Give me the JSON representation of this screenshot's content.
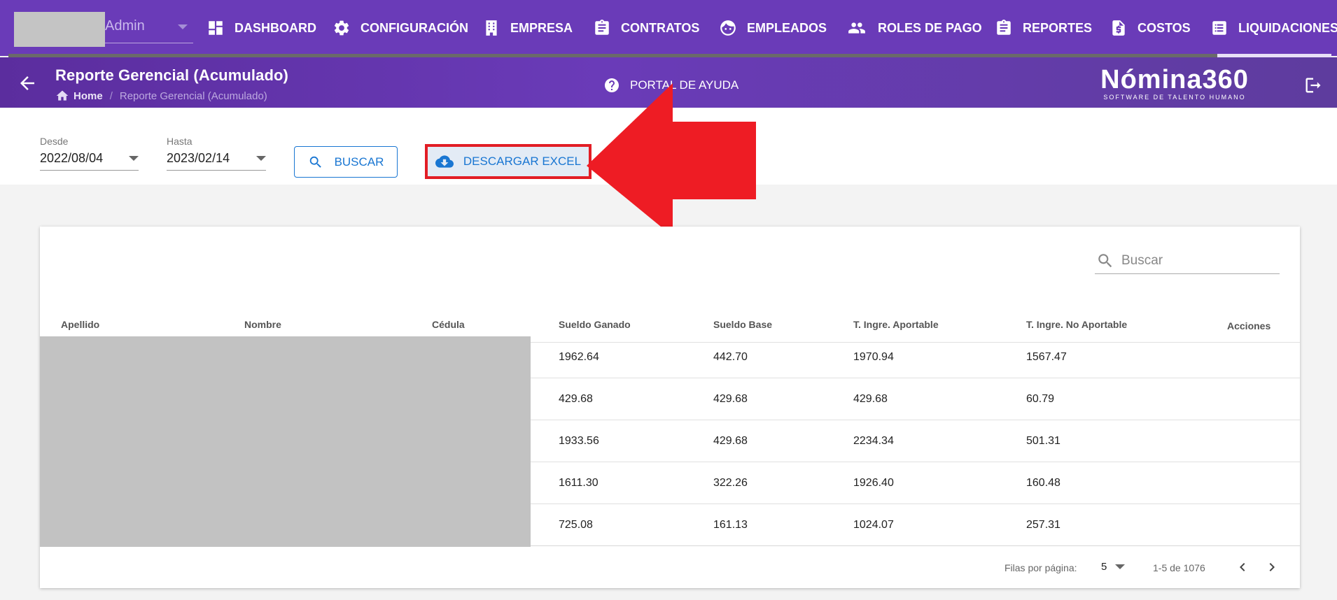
{
  "topnav": {
    "user_name": "Admin",
    "items": [
      {
        "label": "DASHBOARD",
        "icon": "dashboard-icon"
      },
      {
        "label": "CONFIGURACIÓN",
        "icon": "gear-icon"
      },
      {
        "label": "EMPRESA",
        "icon": "building-icon"
      },
      {
        "label": "CONTRATOS",
        "icon": "clipboard-icon"
      },
      {
        "label": "EMPLEADOS",
        "icon": "face-icon"
      },
      {
        "label": "ROLES DE PAGO",
        "icon": "people-icon"
      },
      {
        "label": "REPORTES",
        "icon": "clipboard-icon"
      },
      {
        "label": "COSTOS",
        "icon": "dollar-file-icon"
      },
      {
        "label": "LIQUIDACIONES",
        "icon": "list-icon"
      }
    ]
  },
  "header": {
    "title": "Reporte Gerencial (Acumulado)",
    "breadcrumb": {
      "home": "Home",
      "separator": "/",
      "current": "Reporte Gerencial (Acumulado)"
    },
    "help_label": "PORTAL DE AYUDA",
    "logo_main": "Nómina360",
    "logo_sub": "SOFTWARE DE TALENTO HUMANO"
  },
  "filters": {
    "desde_label": "Desde",
    "desde_value": "2022/08/04",
    "hasta_label": "Hasta",
    "hasta_value": "2023/02/14",
    "buscar_label": "BUSCAR",
    "excel_label": "DESCARGAR EXCEL"
  },
  "table": {
    "search_placeholder": "Buscar",
    "columns": [
      "Apellido",
      "Nombre",
      "Cédula",
      "Sueldo Ganado",
      "Sueldo Base",
      "T. Ingre. Aportable",
      "T. Ingre. No Aportable",
      "Acciones"
    ],
    "rows": [
      {
        "sueldo_ganado": "1962.64",
        "sueldo_base": "442.70",
        "aportable": "1970.94",
        "no_aportable": "1567.47"
      },
      {
        "sueldo_ganado": "429.68",
        "sueldo_base": "429.68",
        "aportable": "429.68",
        "no_aportable": "60.79"
      },
      {
        "sueldo_ganado": "1933.56",
        "sueldo_base": "429.68",
        "aportable": "2234.34",
        "no_aportable": "501.31"
      },
      {
        "sueldo_ganado": "1611.30",
        "sueldo_base": "322.26",
        "aportable": "1926.40",
        "no_aportable": "160.48"
      },
      {
        "sueldo_ganado": "725.08",
        "sueldo_base": "161.13",
        "aportable": "1024.07",
        "no_aportable": "257.31"
      }
    ],
    "footer": {
      "rows_per_page_label": "Filas por página:",
      "rows_per_page": "5",
      "range": "1-5 de 1076"
    }
  },
  "colors": {
    "nav": "#6a3bb8",
    "accent": "#1976d2",
    "highlight": "#e21d25"
  }
}
